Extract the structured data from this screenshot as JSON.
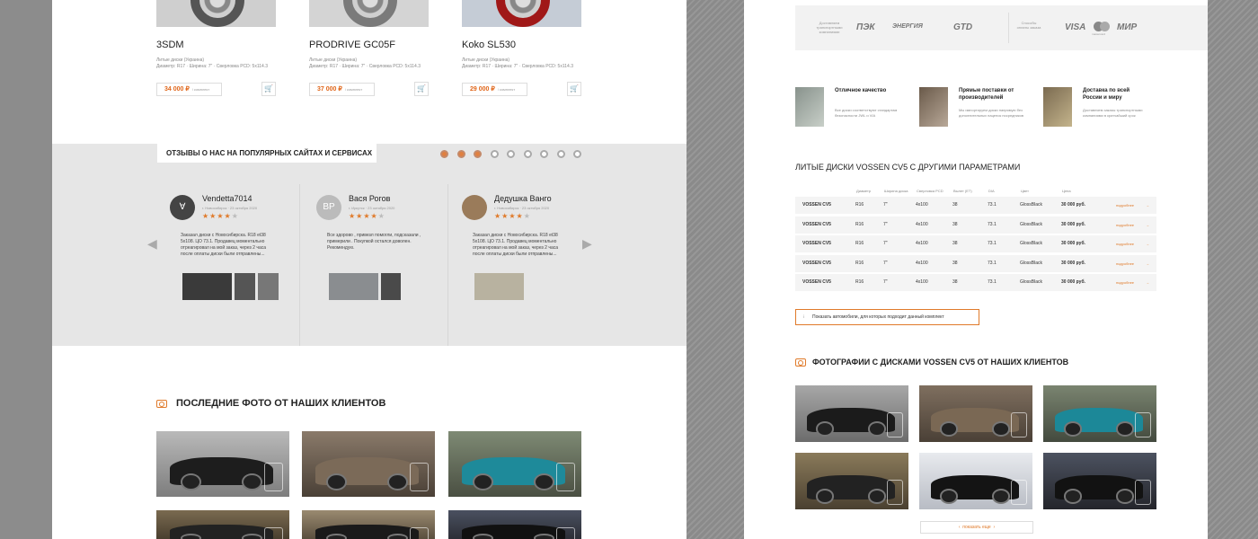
{
  "products": [
    {
      "name": "3SDM",
      "desc": "Литые диски (Украина)\nДиаметр: R17 · Ширина: 7\" · Сверловка PCD: 5x114.3",
      "price": "34 000 ₽",
      "unit": "/ комплект"
    },
    {
      "name": "PRODRIVE GC05F",
      "desc": "Литые диски (Украина)\nДиаметр: R17 · Ширина: 7\" · Сверловка PCD: 5x114.3",
      "price": "37 000 ₽",
      "unit": "/ комплект"
    },
    {
      "name": "Koko SL530",
      "desc": "Литые диски (Украина)\nДиаметр: R17 · Ширина: 7\" · Сверловка PCD: 5x114.3",
      "price": "29 000 ₽",
      "unit": "/ комплект"
    }
  ],
  "reviews_section": {
    "title": "ОТЗЫВЫ О НАС НА ПОПУЛЯРНЫХ САЙТАХ И СЕРВИСАХ",
    "slides_total": 9,
    "slides_active": 3,
    "items": [
      {
        "initials": "∀",
        "name": "Vendetta7014",
        "meta": "г. Новосибирск · 23 октября 2020",
        "rating": 4,
        "text": "Заказал диски с Новосибирска. R18 et38 5x108. ЦО 73.1. Продавец моментально отреагировал на мой заказ, через 2 часа после оплаты диски были отправлены..."
      },
      {
        "initials": "ВР",
        "name": "Вася Рогов",
        "meta": "г. Иркутск · 23 октября 2020",
        "rating": 4,
        "text": "Все здорово , привезл помогли, подсказали , примерили . Покупкой остался доволен. Рекомендую."
      },
      {
        "initials": "",
        "name": "Дедушка Ванго",
        "meta": "г. Новосибирск · 23 октября 2020",
        "rating": 4,
        "text": "Заказал диски с Новосибирска. R18 et38 5x108. ЦО 73.1. Продавец моментально отреагировал на мой заказ, через 2 часа после оплаты диски были отправлены..."
      }
    ]
  },
  "left_photos": {
    "title": "ПОСЛЕДНИЕ ФОТО ОТ НАШИХ КЛИЕНТОВ"
  },
  "delivery": {
    "label": "Доставляем транспортными компаниями",
    "companies": [
      "ПЭК",
      "ЭНЕРГИЯ",
      "GTD"
    ],
    "pay_label": "Способы оплаты заказа",
    "payments": [
      "VISA",
      "mastercard",
      "МИР"
    ]
  },
  "features": [
    {
      "title": "Отличное качество",
      "text": "Все диски соответствуют стандартам безопасности JWL и VIA"
    },
    {
      "title": "Прямые поставки от производителей",
      "text": "Мы импортируем диски напрямую без дополнительных наценок посредников"
    },
    {
      "title": "Доставка по всей России и миру",
      "text": "Доставляем заказы транспортными компаниями в кратчайший срок"
    }
  ],
  "table": {
    "title": "ЛИТЫЕ ДИСКИ VOSSEN CV5 С ДРУГИМИ ПАРАМЕТРАМИ",
    "headers": [
      "Диаметр",
      "Ширина диска",
      "Сверловка PCD",
      "Вылет (ET)",
      "DIA",
      "Цвет",
      "Цена"
    ],
    "rows": [
      {
        "model": "VOSSEN CV5",
        "d": "R16",
        "w": "7\"",
        "pcd": "4x100",
        "et": "38",
        "dia": "73.1",
        "color": "GlossBlack",
        "price": "30 000 руб.",
        "link": "подробнее"
      },
      {
        "model": "VOSSEN CV5",
        "d": "R16",
        "w": "7\"",
        "pcd": "4x100",
        "et": "38",
        "dia": "73.1",
        "color": "GlossBlack",
        "price": "30 000 руб.",
        "link": "подробнее"
      },
      {
        "model": "VOSSEN CV5",
        "d": "R16",
        "w": "7\"",
        "pcd": "4x100",
        "et": "38",
        "dia": "73.1",
        "color": "GlossBlack",
        "price": "30 000 руб.",
        "link": "подробнее"
      },
      {
        "model": "VOSSEN CV5",
        "d": "R16",
        "w": "7\"",
        "pcd": "4x100",
        "et": "38",
        "dia": "73.1",
        "color": "GlossBlack",
        "price": "30 000 руб.",
        "link": "подробнее"
      },
      {
        "model": "VOSSEN CV5",
        "d": "R16",
        "w": "7\"",
        "pcd": "4x100",
        "et": "38",
        "dia": "73.1",
        "color": "GlossBlack",
        "price": "30 000 руб.",
        "link": "подробнее"
      }
    ],
    "show_button": "Показать автомобили, для которых подходит данный комплект"
  },
  "right_photos": {
    "title": "ФОТОГРАФИИ С ДИСКАМИ VOSSEN CV5 ОТ НАШИХ КЛИЕНТОВ",
    "more": "показать еще"
  },
  "colors": {
    "accent": "#e07a2a",
    "band": "#e6e6e6"
  }
}
